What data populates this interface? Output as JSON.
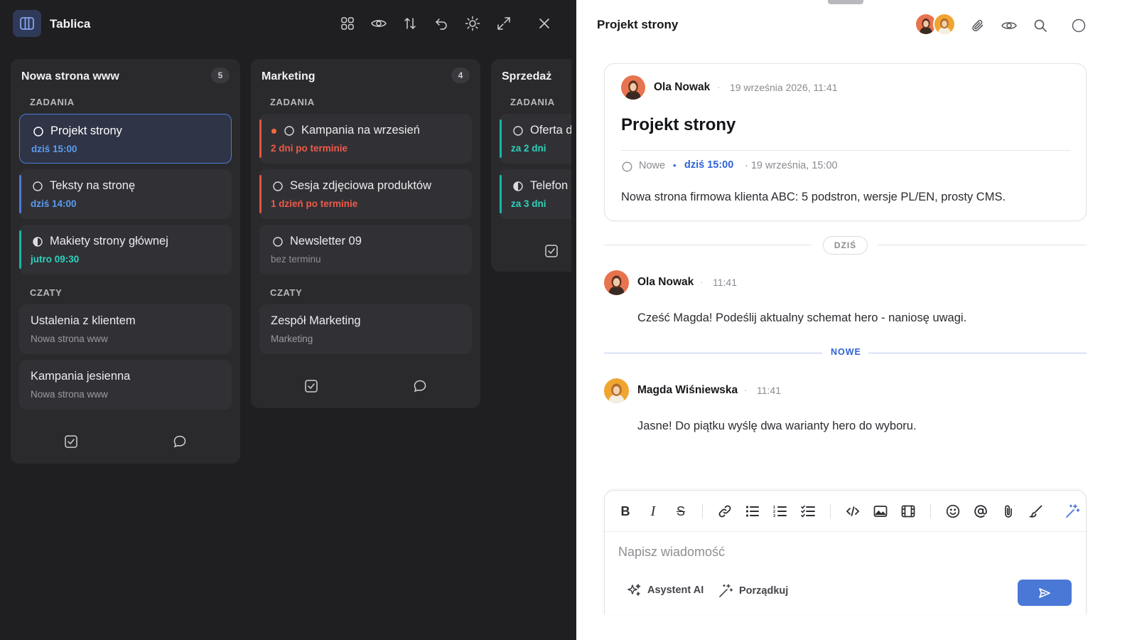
{
  "board": {
    "title": "Tablica",
    "columns": [
      {
        "name": "Nowa strona www",
        "count": "5",
        "tasks_label": "ZADANIA",
        "tasks": [
          {
            "title": "Projekt strony",
            "meta": "dziś 15:00",
            "status": "circle-icon"
          },
          {
            "title": "Teksty na stronę",
            "meta": "dziś 14:00",
            "status": "circle-icon"
          },
          {
            "title": "Makiety strony głównej",
            "meta": "jutro 09:30",
            "status": "half-circle-icon"
          }
        ],
        "chats_label": "CZATY",
        "chats": [
          {
            "title": "Ustalenia z klientem",
            "meta": "Nowa strona www"
          },
          {
            "title": "Kampania jesienna",
            "meta": "Nowa strona www"
          }
        ]
      },
      {
        "name": "Marketing",
        "count": "4",
        "tasks_label": "ZADANIA",
        "tasks": [
          {
            "title": "Kampania na wrzesień",
            "meta": "2 dni po terminie",
            "status": "circle-icon"
          },
          {
            "title": "Sesja zdjęciowa produktów",
            "meta": "1 dzień po terminie",
            "status": "circle-icon"
          },
          {
            "title": "Newsletter 09",
            "meta": "bez terminu",
            "status": "circle-icon"
          }
        ],
        "chats_label": "CZATY",
        "chats": [
          {
            "title": "Zespół Marketing",
            "meta": "Marketing"
          }
        ]
      },
      {
        "name": "Sprzedaż",
        "tasks_label": "ZADANIA",
        "tasks": [
          {
            "title": "Oferta d",
            "meta": "za 2 dni",
            "status": "circle-icon"
          },
          {
            "title": "Telefon",
            "meta": "za 3 dni",
            "status": "half-circle-icon"
          }
        ]
      }
    ]
  },
  "panel": {
    "title": "Projekt strony",
    "task": {
      "author": "Ola Nowak",
      "created": "19 września 2026, 11:41",
      "title": "Projekt strony",
      "status": "Nowe",
      "due": "dziś 15:00",
      "due_full": "· 19 września, 15:00",
      "description": "Nowa strona firmowa klienta ABC: 5 podstron, wersje PL/EN, prosty CMS."
    },
    "day_separator": "DZIŚ",
    "new_separator": "NOWE",
    "messages": [
      {
        "author": "Ola Nowak",
        "time": "11:41",
        "text": "Cześć Magda! Podeślij aktualny schemat hero - naniosę uwagi."
      },
      {
        "author": "Magda Wiśniewska",
        "time": "11:41",
        "text": "Jasne! Do piątku wyślę dwa warianty hero do wyboru."
      }
    ],
    "composer": {
      "placeholder": "Napisz wiadomość",
      "ai_label": "Asystent AI",
      "tidy_label": "Porządkuj"
    }
  },
  "colors": {
    "accent": "#4a78d6",
    "overdue": "#e5533d",
    "teal": "#14b8a6",
    "blue_bar": "#4d79d6",
    "due_blue": "#5b9cf0",
    "due_teal": "#2fd1bd"
  }
}
